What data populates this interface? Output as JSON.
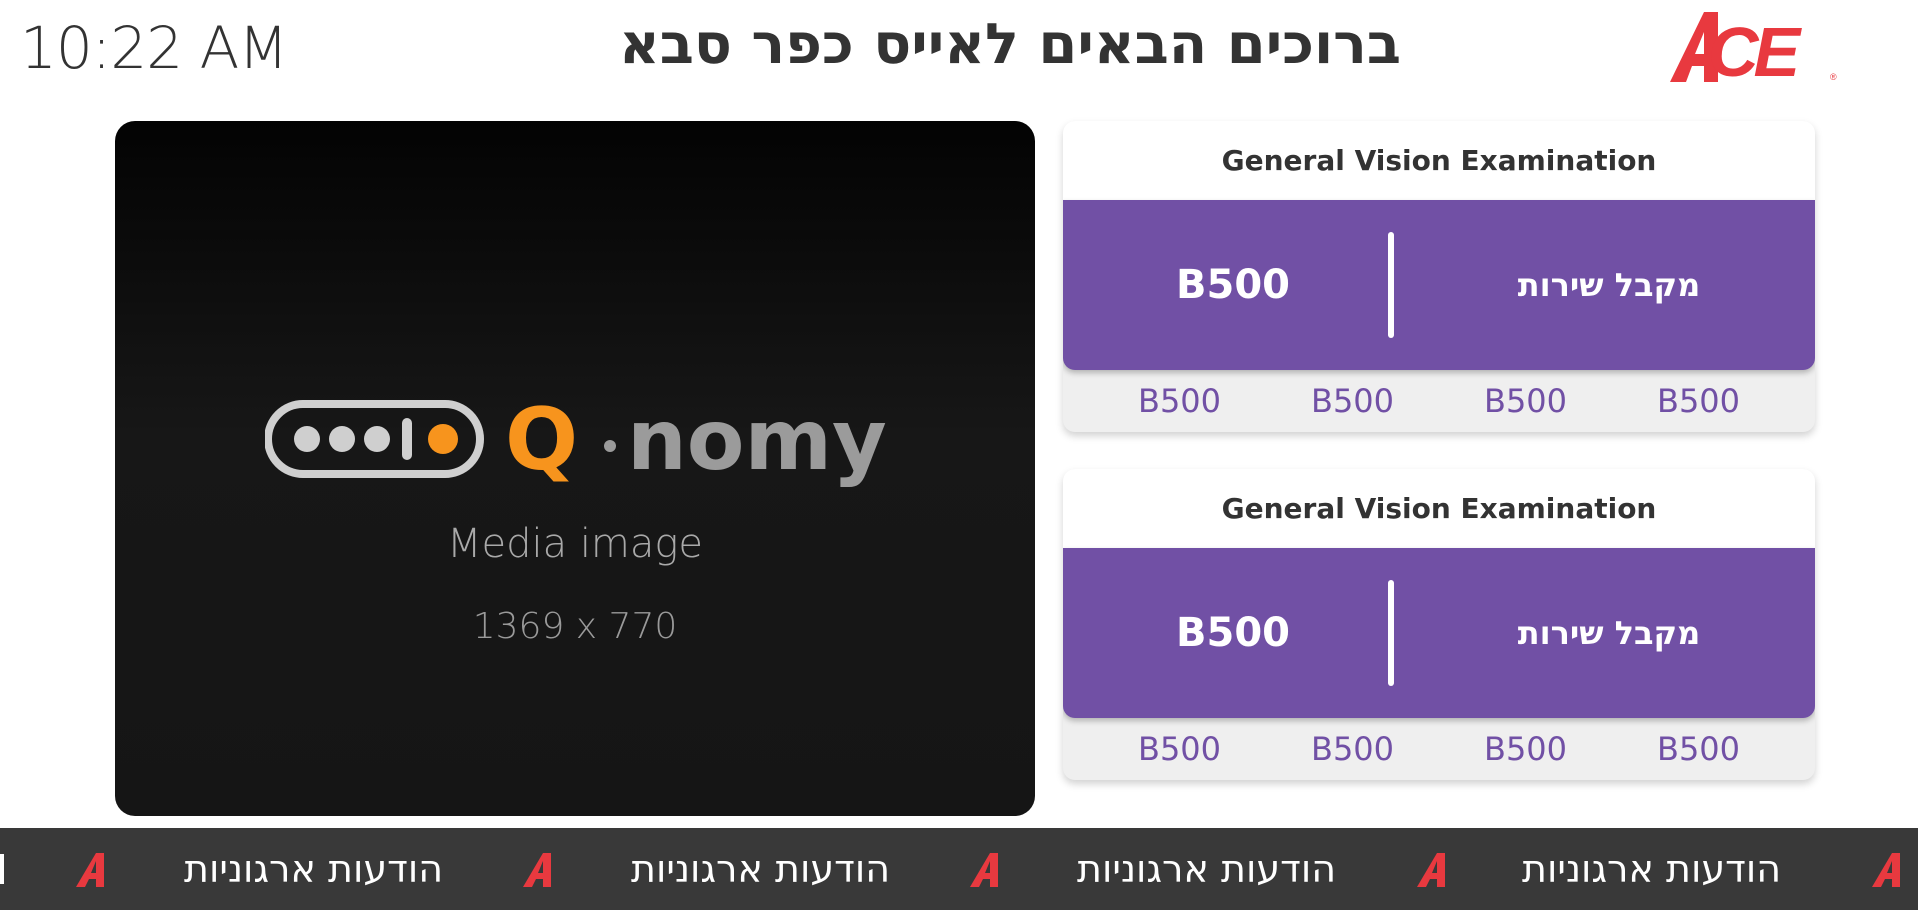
{
  "header": {
    "clock": "10:22 AM",
    "welcome": "ברוכים הבאים לאייס כפר סבא",
    "logo_icon": "ace-logo",
    "logo_text": "ACE",
    "brand_color": "#e8393f"
  },
  "media": {
    "logo_text": "Q·nomy",
    "caption": "Media image",
    "size_text": "1369 x 770"
  },
  "cards": [
    {
      "title": "General Vision Examination",
      "number": "B500",
      "label": "מקבל שירות",
      "queue": [
        "B500",
        "B500",
        "B500",
        "B500"
      ]
    },
    {
      "title": "General Vision Examination",
      "number": "B500",
      "label": "מקבל שירות",
      "queue": [
        "B500",
        "B500",
        "B500",
        "B500"
      ]
    }
  ],
  "ticker": {
    "items": [
      "הודעות ארגוניות",
      "הודעות ארגוניות",
      "הודעות ארגוניות",
      "הודעות ארגוניות"
    ],
    "icon": "ace-a-icon"
  },
  "colors": {
    "accent": "#7150a5",
    "ticker_bg": "#393939",
    "qnomy_orange": "#f7941d"
  }
}
